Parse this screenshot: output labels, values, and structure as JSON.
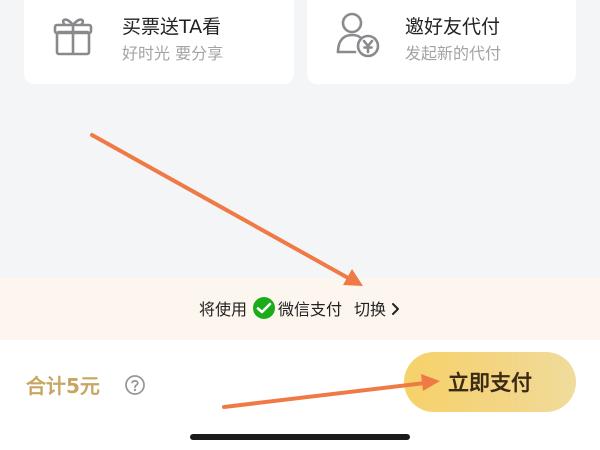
{
  "cards": [
    {
      "title": "买票送TA看",
      "subtitle": "好时光 要分享",
      "icon": "gift-icon"
    },
    {
      "title": "邀好友代付",
      "subtitle": "发起新的代付",
      "icon": "user-yuan-icon"
    }
  ],
  "payment_notice": {
    "prefix": "将使用",
    "method": "微信支付",
    "method_icon": "wechat-pay-icon",
    "switch_label": "切换",
    "switch_icon": "chevron-right-icon"
  },
  "footer": {
    "total_label": "合计5元",
    "help_icon": "question-circle-icon",
    "pay_button_label": "立即支付"
  },
  "annotations": {
    "arrow_color": "#f07a45",
    "arrows": [
      "arrow-to-payment-method",
      "arrow-to-pay-button"
    ]
  },
  "colors": {
    "total_text": "#c8a662",
    "pay_button": "#f5d373",
    "notice_background": "#fdf6ee",
    "wechat_green": "#1aad19"
  }
}
